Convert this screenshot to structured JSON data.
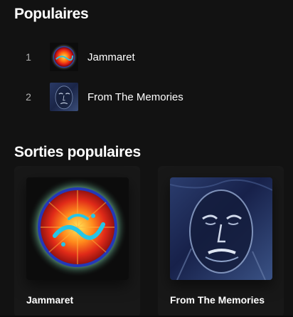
{
  "popular": {
    "title": "Populaires",
    "tracks": [
      {
        "number": "1",
        "title": "Jammaret"
      },
      {
        "number": "2",
        "title": "From The Memories"
      }
    ]
  },
  "releases": {
    "title": "Sorties populaires",
    "items": [
      {
        "title": "Jammaret"
      },
      {
        "title": "From The Memories"
      }
    ]
  },
  "colors": {
    "background": "#121212",
    "card_background": "#181818",
    "text_primary": "#ffffff",
    "text_secondary": "#b3b3b3"
  }
}
